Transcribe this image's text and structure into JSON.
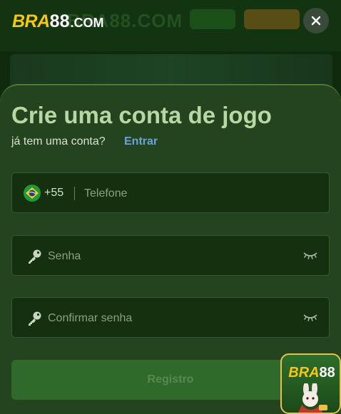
{
  "logo": {
    "brand": "BRA",
    "number": "88",
    "suffix": ".COM"
  },
  "modal": {
    "title": "Crie uma conta de jogo",
    "subtitle": "já tem uma conta?",
    "login_link": "Entrar"
  },
  "form": {
    "country_code": "+55",
    "phone_placeholder": "Telefone",
    "password_placeholder": "Senha",
    "confirm_placeholder": "Confirmar senha",
    "register_label": "Registro"
  },
  "badge": {
    "brand": "BRA",
    "number": "88"
  },
  "colors": {
    "accent_green": "#b9d7a5",
    "link_blue": "#6aa3d8",
    "brand_yellow": "#f5c518",
    "modal_bg": "#24441f"
  },
  "icons": [
    "close-icon",
    "brazil-flag-icon",
    "key-icon",
    "eye-closed-icon"
  ]
}
